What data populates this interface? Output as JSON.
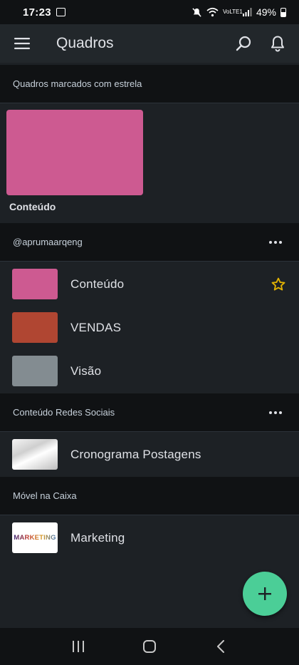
{
  "status_bar": {
    "time": "17:23",
    "battery": "49%",
    "network": "VoLTE1"
  },
  "app_bar": {
    "title": "Quadros"
  },
  "starred": {
    "header": "Quadros marcados com estrela",
    "boards": [
      {
        "name": "Conteúdo",
        "color": "#cd5a91"
      }
    ]
  },
  "workspaces": [
    {
      "name": "@aprumaarqeng",
      "boards": [
        {
          "name": "Conteúdo",
          "color": "#cd5a91",
          "starred": true
        },
        {
          "name": "VENDAS",
          "color": "#b04632",
          "starred": false
        },
        {
          "name": "Visão",
          "color": "#838c91",
          "starred": false
        }
      ]
    },
    {
      "name": "Conteúdo Redes Sociais",
      "boards": [
        {
          "name": "Cronograma Postagens",
          "thumbnail": "photo",
          "starred": false
        }
      ]
    },
    {
      "name": "Móvel na Caixa",
      "boards": [
        {
          "name": "Marketing",
          "thumbnail": "marketing-image",
          "thumbnail_text": "MARKETING",
          "starred": false
        }
      ]
    }
  ],
  "colors": {
    "accent_fab": "#4bce97",
    "star": "#e2b203"
  },
  "icons": {
    "menu": "hamburger-icon",
    "search": "search-icon",
    "notifications": "bell-icon",
    "more": "more-horizontal-icon",
    "star": "star-outline-icon",
    "add": "plus-icon",
    "nav_recents": "recents-icon",
    "nav_home": "home-icon",
    "nav_back": "back-icon"
  }
}
